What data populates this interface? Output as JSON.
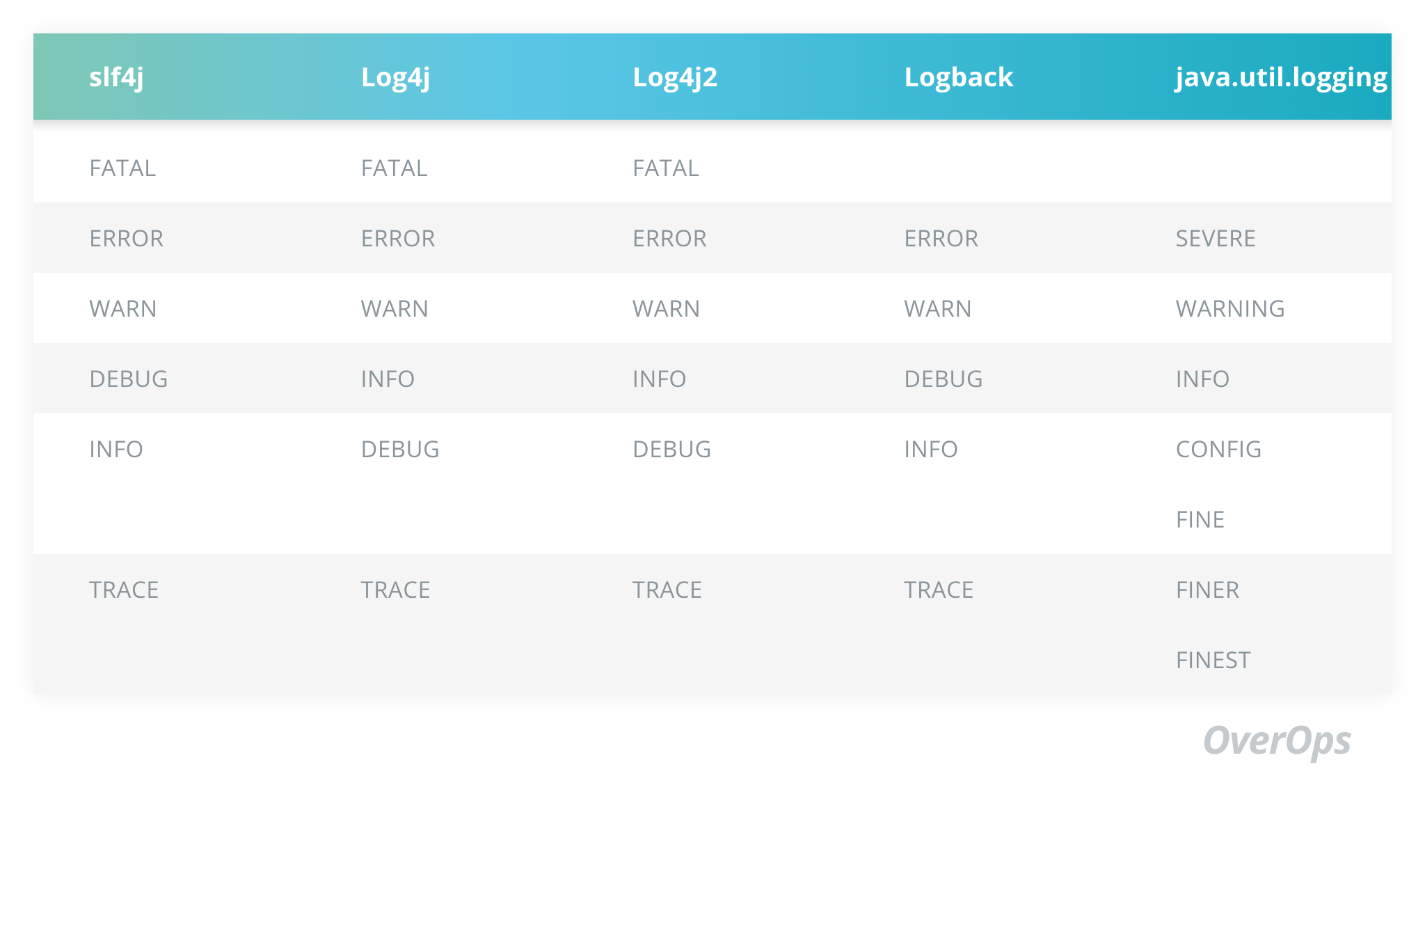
{
  "chart_data": {
    "type": "table",
    "title": "",
    "columns": [
      "slf4j",
      "Log4j",
      "Log4j2",
      "Logback",
      "java.util.logging"
    ],
    "rows": [
      [
        "FATAL",
        "FATAL",
        "FATAL",
        "",
        ""
      ],
      [
        "ERROR",
        "ERROR",
        "ERROR",
        "ERROR",
        "SEVERE"
      ],
      [
        "WARN",
        "WARN",
        "WARN",
        "WARN",
        "WARNING"
      ],
      [
        "DEBUG",
        "INFO",
        "INFO",
        "DEBUG",
        "INFO"
      ],
      [
        "INFO",
        "DEBUG",
        "DEBUG",
        "INFO",
        "CONFIG"
      ],
      [
        "",
        "",
        "",
        "",
        "FINE"
      ],
      [
        "TRACE",
        "TRACE",
        "TRACE",
        "TRACE",
        "FINER"
      ],
      [
        "",
        "",
        "",
        "",
        "FINEST"
      ]
    ],
    "row_shades": [
      "white",
      "gray",
      "white",
      "gray",
      "white",
      "white",
      "gray",
      "gray"
    ]
  },
  "brand": "OverOps"
}
